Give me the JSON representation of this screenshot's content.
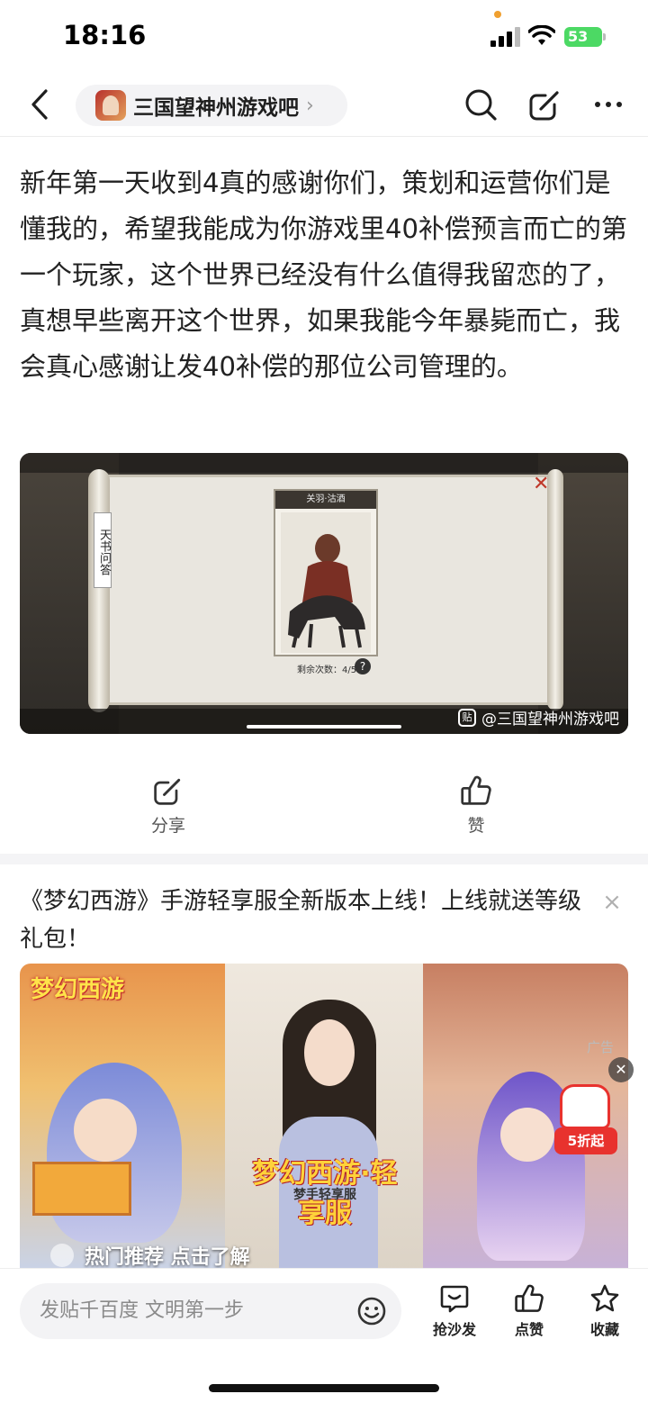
{
  "status_bar": {
    "time": "18:16",
    "battery": "53"
  },
  "nav": {
    "forum_name": "三国望神州游戏吧",
    "chevron": "›"
  },
  "post": {
    "body": "新年第一天收到4真的感谢你们，策划和运营你们是懂我的，希望我能成为你游戏里40补偿预言而亡的第一个玩家，这个世界已经没有什么值得我留恋的了，真想早些离开这个世界，如果我能今年暴毙而亡，我会真心感谢让发40补偿的那位公司管理的。",
    "image": {
      "scroll_tag": "天书问答",
      "card_title": "关羽·沽酒",
      "remaining": "剩余次数：4/5",
      "help": "?",
      "watermark_icon": "贴",
      "watermark": "@三国望神州游戏吧"
    }
  },
  "actions": {
    "share_label": "分享",
    "like_label": "赞"
  },
  "ad": {
    "title": "《梦幻西游》手游轻享服全新版本上线！上线就送等级礼包！",
    "close": "×",
    "ad_label": "广告",
    "ad_dismiss": "✕",
    "logo_text": "梦幻西游",
    "center_logo": "梦幻西游·轻享服",
    "center_sub": "梦手轻享服",
    "promo_badge": "5折起",
    "cta": "热门推荐 点击了解"
  },
  "bottom_bar": {
    "placeholder": "发贴千百度 文明第一步",
    "sofa_label": "抢沙发",
    "like_label": "点赞",
    "favorite_label": "收藏"
  }
}
